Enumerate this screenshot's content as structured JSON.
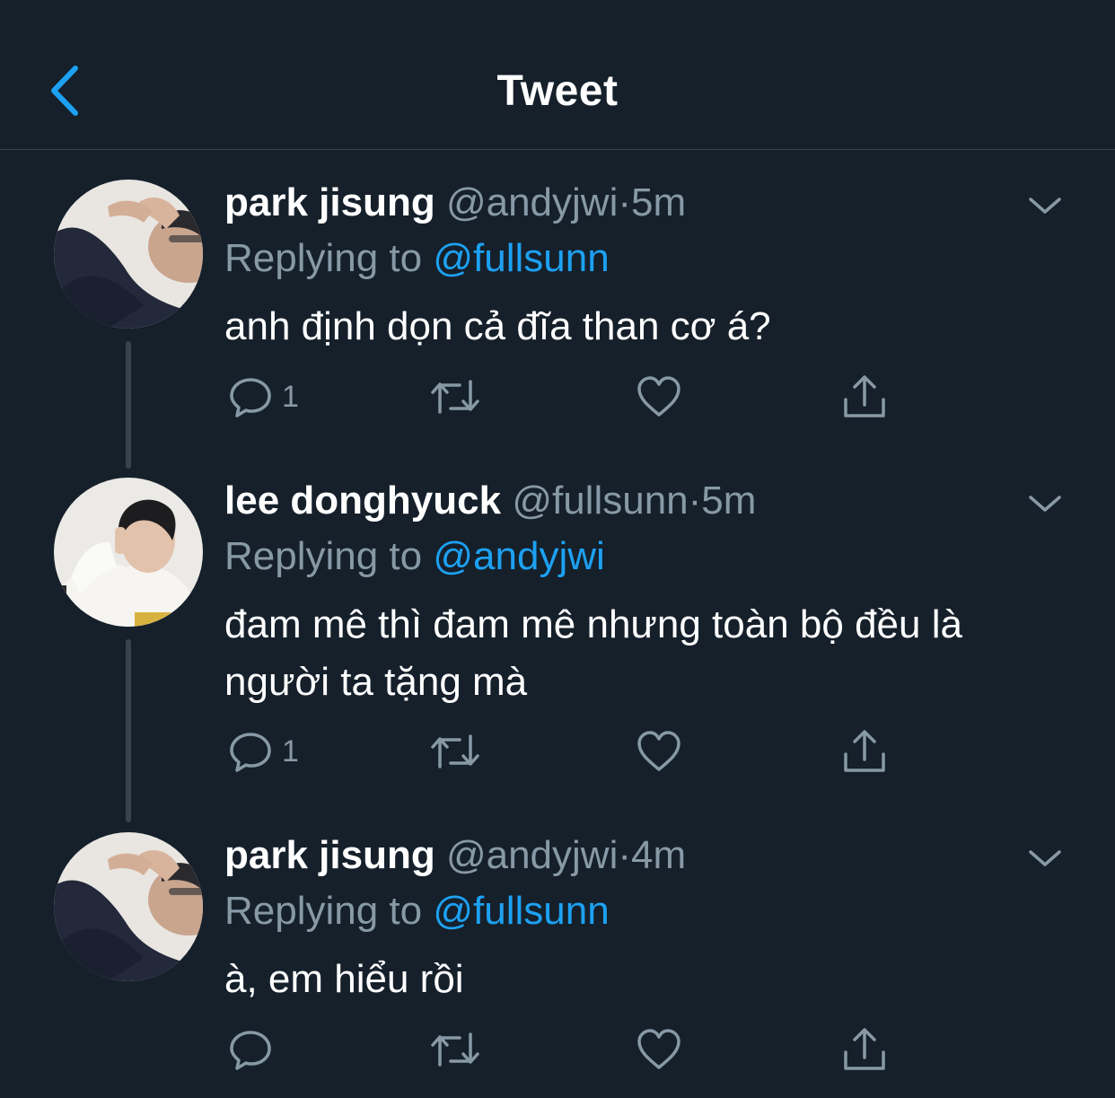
{
  "header": {
    "title": "Tweet",
    "back_icon": "chevron-left-icon",
    "accent": "#1da1f2"
  },
  "colors": {
    "background": "#15202b",
    "muted": "#8899a6",
    "divider": "#38444d",
    "link": "#1da1f2"
  },
  "tweets": [
    {
      "name": "park jisung",
      "handle": "@andyjwi",
      "separator": "·",
      "time": "5m",
      "reply_prefix": "Replying to ",
      "reply_mention": "@fullsunn",
      "text": "anh định dọn cả đĩa than cơ á?",
      "reply_count": "1",
      "retweet_count": "",
      "like_count": ""
    },
    {
      "name": "lee donghyuck",
      "handle": "@fullsunn",
      "separator": "·",
      "time": "5m",
      "reply_prefix": "Replying to ",
      "reply_mention": "@andyjwi",
      "text": "đam mê thì đam mê nhưng toàn bộ đều là người ta tặng mà",
      "reply_count": "1",
      "retweet_count": "",
      "like_count": ""
    },
    {
      "name": "park jisung",
      "handle": "@andyjwi",
      "separator": "·",
      "time": "4m",
      "reply_prefix": "Replying to ",
      "reply_mention": "@fullsunn",
      "text": "à, em hiểu rồi",
      "reply_count": "",
      "retweet_count": "",
      "like_count": ""
    }
  ],
  "icons": {
    "reply": "reply-icon",
    "retweet": "retweet-icon",
    "like": "heart-icon",
    "share": "share-icon",
    "more": "chevron-down-icon"
  }
}
